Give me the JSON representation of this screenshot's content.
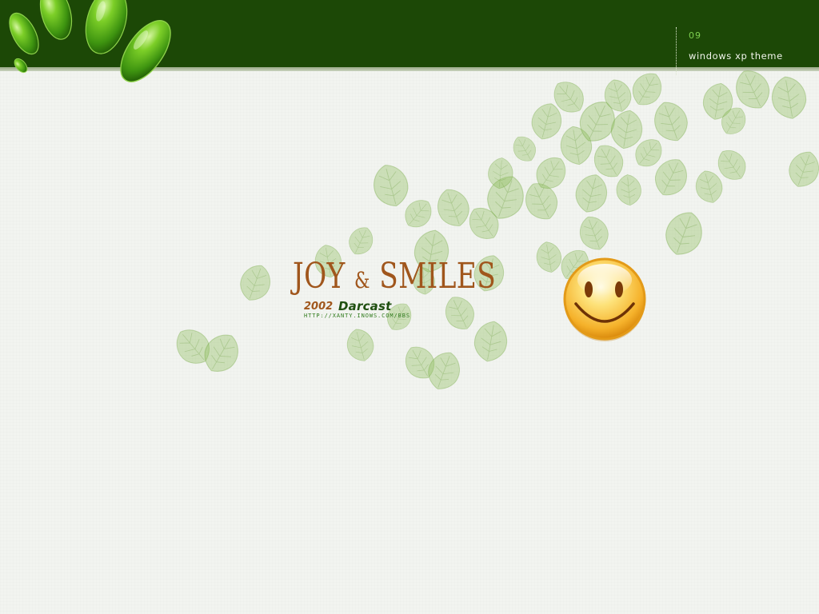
{
  "header": {
    "number": "09",
    "label": "windows xp theme"
  },
  "logo": {
    "title_part1": "JOY",
    "ampersand": "&",
    "title_part2": "SMILES",
    "year": "2002",
    "brand": "Darcast",
    "url": "HTTP://XANTY.INOWS.COM/BBS"
  },
  "colors": {
    "band": "#1c4806",
    "background": "#f2f4f0",
    "title": "#a0561c",
    "brand": "#1f4f10",
    "accent_green": "#7ed050",
    "leaf": "#8fbd5c"
  },
  "icons": {
    "corner_decoration": "green-drops-icon",
    "smiley": "smiley-face-icon",
    "leaves": "leaf-icon"
  }
}
